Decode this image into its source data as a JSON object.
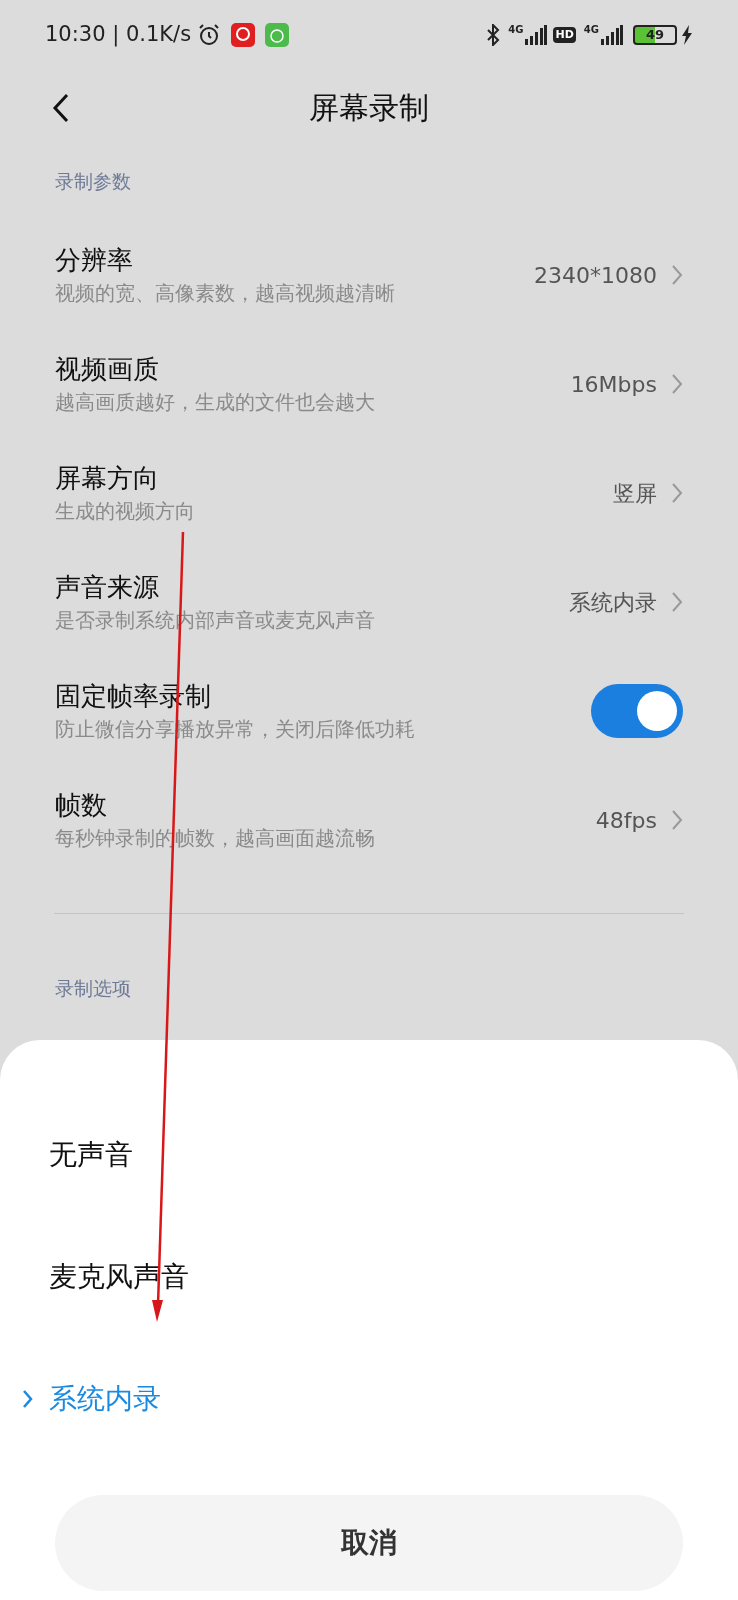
{
  "status_bar": {
    "time": "10:30 | 0.1K/s",
    "network_1": "4G",
    "hd": "HD",
    "network_2": "4G",
    "battery": "49"
  },
  "header": {
    "title": "屏幕录制"
  },
  "section_1": {
    "title": "录制参数"
  },
  "settings": [
    {
      "kind": "value",
      "title": "分辨率",
      "subtitle": "视频的宽、高像素数，越高视频越清晰",
      "value": "2340*1080"
    },
    {
      "kind": "value",
      "title": "视频画质",
      "subtitle": "越高画质越好，生成的文件也会越大",
      "value": "16Mbps"
    },
    {
      "kind": "value",
      "title": "屏幕方向",
      "subtitle": "生成的视频方向",
      "value": "竖屏"
    },
    {
      "kind": "value",
      "title": "声音来源",
      "subtitle": "是否录制系统内部声音或麦克风声音",
      "value": "系统内录"
    },
    {
      "kind": "toggle",
      "title": "固定帧率录制",
      "subtitle": "防止微信分享播放异常，关闭后降低功耗",
      "on": true
    },
    {
      "kind": "value",
      "title": "帧数",
      "subtitle": "每秒钟录制的帧数，越高画面越流畅",
      "value": "48fps"
    }
  ],
  "section_2": {
    "title": "录制选项"
  },
  "sheet": {
    "options": [
      {
        "label": "无声音",
        "selected": false
      },
      {
        "label": "麦克风声音",
        "selected": false
      },
      {
        "label": "系统内录",
        "selected": true
      }
    ],
    "cancel": "取消"
  }
}
